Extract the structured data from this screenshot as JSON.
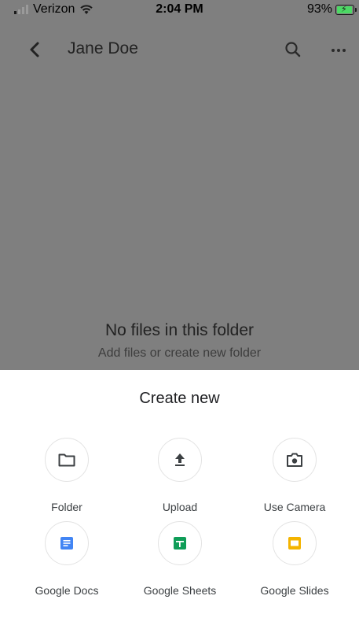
{
  "status_bar": {
    "carrier": "Verizon",
    "time": "2:04 PM",
    "battery": "93%",
    "battery_level": 0.93
  },
  "header": {
    "title": "Jane Doe",
    "back_icon": "chevron-left-icon",
    "search_icon": "search-icon",
    "more_icon": "more-horizontal-icon"
  },
  "empty_state": {
    "title": "No files in this folder",
    "subtitle": "Add files or create new folder"
  },
  "create_sheet": {
    "title": "Create new",
    "options": [
      {
        "label": "Folder",
        "icon": "folder-icon"
      },
      {
        "label": "Upload",
        "icon": "upload-icon"
      },
      {
        "label": "Use Camera",
        "icon": "camera-icon"
      },
      {
        "label": "Google Docs",
        "icon": "google-docs-icon",
        "color": "#4285f4"
      },
      {
        "label": "Google Sheets",
        "icon": "google-sheets-icon",
        "color": "#0f9d58"
      },
      {
        "label": "Google Slides",
        "icon": "google-slides-icon",
        "color": "#f4b400"
      }
    ]
  },
  "colors": {
    "backdrop": "#7f7f7f",
    "battery_fill": "#4cd964"
  }
}
